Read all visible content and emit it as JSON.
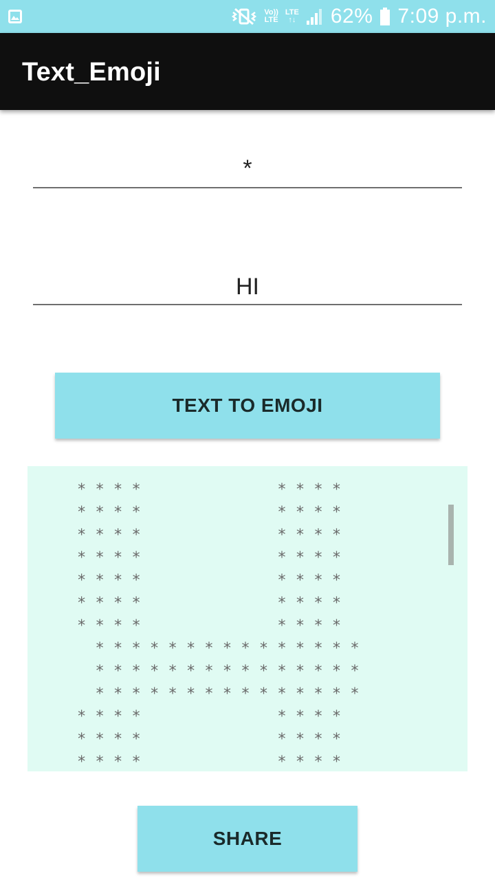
{
  "status_bar": {
    "volte_top": "Vo))",
    "volte_bottom": "LTE",
    "lte_label": "LTE",
    "battery": "62%",
    "time": "7:09 p.m."
  },
  "app_bar": {
    "title": "Text_Emoji"
  },
  "inputs": {
    "emoji_char": "*",
    "text_value": "HI"
  },
  "buttons": {
    "convert": "TEXT TO EMOJI",
    "share": "SHARE"
  },
  "output": {
    "art": "* * * *               * * * *\n* * * *               * * * *\n* * * *               * * * *\n* * * *               * * * *\n* * * *               * * * *\n* * * *               * * * *\n* * * *               * * * *\n  * * * * * * * * * * * * * * *\n  * * * * * * * * * * * * * * *\n  * * * * * * * * * * * * * * *\n* * * *               * * * *\n* * * *               * * * *\n* * * *               * * * *"
  }
}
